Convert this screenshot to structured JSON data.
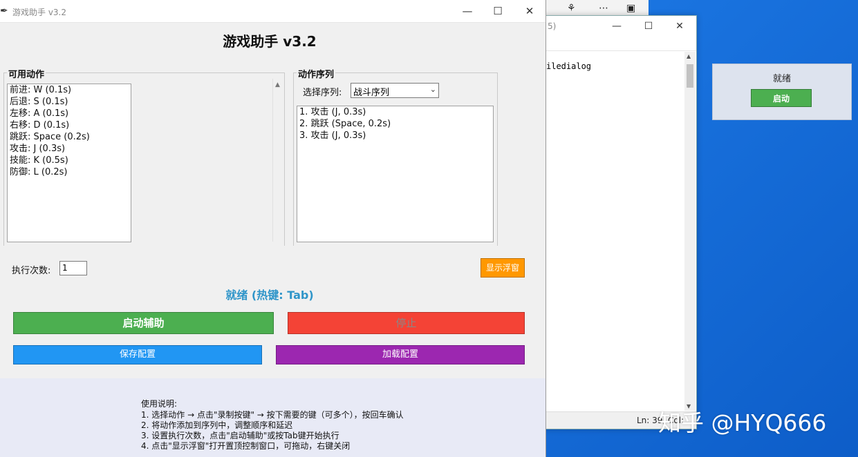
{
  "main_window": {
    "title": "游戏助手 v3.2",
    "heading": "游戏助手 v3.2",
    "available_actions": {
      "label": "可用动作",
      "items": [
        "前进: W (0.1s)",
        "后退: S (0.1s)",
        "左移: A (0.1s)",
        "右移: D (0.1s)",
        "跳跃: Space (0.2s)",
        "攻击: J (0.3s)",
        "技能: K (0.5s)",
        "防御: L (0.2s)"
      ]
    },
    "action_sequence": {
      "label": "动作序列",
      "select_label": "选择序列:",
      "selected": "战斗序列",
      "items": [
        "1. 攻击 (J, 0.3s)",
        "2. 跳跃 (Space, 0.2s)",
        "3. 攻击 (J, 0.3s)"
      ]
    },
    "exec_count": {
      "label": "执行次数:",
      "value": "1"
    },
    "float_button": "显示浮窗",
    "status": "就绪 (热键: Tab)",
    "buttons": {
      "start": "启动辅助",
      "stop": "停止",
      "save": "保存配置",
      "load": "加载配置"
    },
    "instructions": [
      "使用说明:",
      "1. 选择动作 → 点击\"录制按键\" → 按下需要的键（可多个），按回车确认",
      "2. 将动作添加到序列中，调整顺序和延迟",
      "3. 设置执行次数，点击\"启动辅助\"或按Tab键开始执行",
      "4. 点击\"显示浮窗\"打开置顶控制窗口，可拖动，右键关闭"
    ]
  },
  "notepad": {
    "title_fragment": "5)",
    "text_fragment": "iledialog",
    "status_fragment": "Ln: 39, Col:"
  },
  "floating_panel": {
    "status": "就绪",
    "start": "启动"
  },
  "watermark": "知乎 @HYQ666",
  "colors": {
    "start_green": "#4caf50",
    "stop_red": "#f44336",
    "save_blue": "#2196f3",
    "load_purple": "#9c27b0",
    "float_orange": "#ff9800",
    "status_blue": "#2f95c9"
  }
}
